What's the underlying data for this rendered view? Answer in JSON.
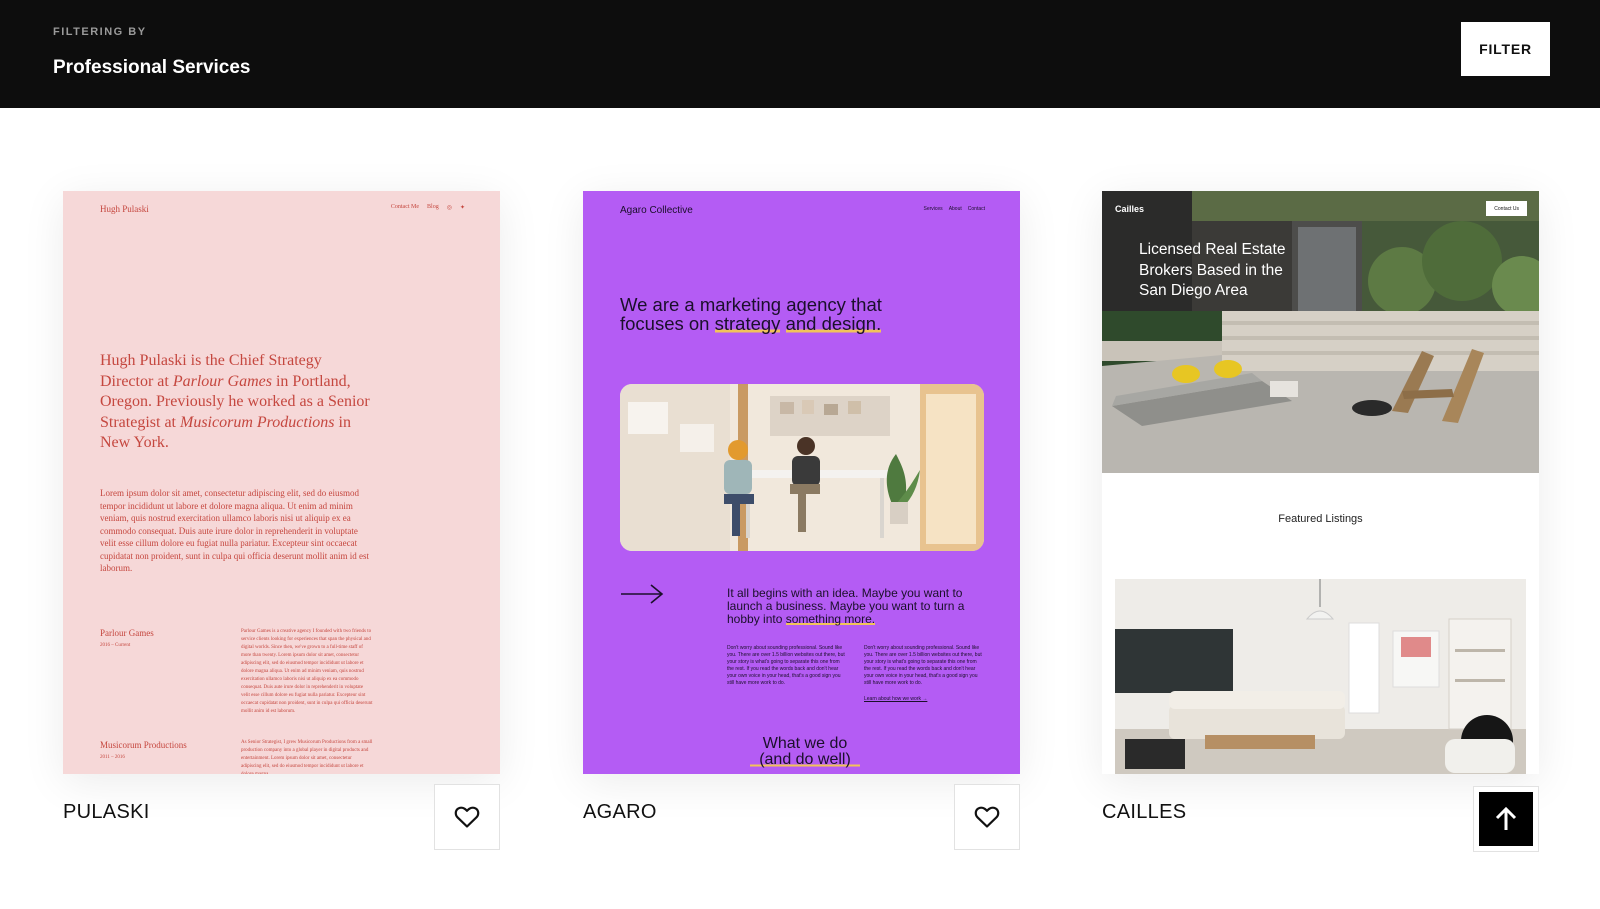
{
  "filter": {
    "eyebrow": "FILTERING BY",
    "value": "Professional Services",
    "button_label": "FILTER"
  },
  "templates": [
    {
      "name": "PULASKI",
      "bg_color": "#f6d8d8",
      "text_color": "#c5473f",
      "brand": "Hugh Pulaski",
      "nav": [
        "Contact Me",
        "Blog"
      ],
      "headline_parts": [
        "Hugh Pulaski is the Chief Strategy Director at ",
        "Parlour Games",
        " in Portland, Oregon. Previously he worked as a Senior Strategist at ",
        "Musicorum Productions",
        " in New York."
      ],
      "lorem": "Lorem ipsum dolor sit amet, consectetur adipiscing elit, sed do eiusmod tempor incididunt ut labore et dolore magna aliqua. Ut enim ad minim veniam, quis nostrud exercitation ullamco laboris nisi ut aliquip ex ea commodo consequat. Duis aute irure dolor in reprehenderit in voluptate velit esse cillum dolore eu fugiat nulla pariatur. Excepteur sint occaecat cupidatat non proident, sunt in culpa qui officia deserunt mollit anim id est laborum.",
      "section1_title": "Parlour Games",
      "section1_dates": "2016 – Current",
      "section1_body": "Parlour Games is a creative agency I founded with two friends to service clients looking for experiences that span the physical and digital worlds. Since then, we've grown to a full-time staff of more than twenty. Lorem ipsum dolor sit amet, consectetur adipiscing elit, sed do eiusmod tempor incididunt ut labore et dolore magna aliqua. Ut enim ad minim veniam, quis nostrud exercitation ullamco laboris nisi ut aliquip ex ea commodo consequat. Duis aute irure dolor in reprehenderit in voluptate velit esse cillum dolore eu fugiat nulla pariatur. Excepteur sint occaecat cupidatat non proident, sunt in culpa qui officia deserunt mollit anim id est laborum.",
      "section2_title": "Musicorum Productions",
      "section2_dates": "2011 – 2016",
      "section2_body": "As Senior Strategist, I grew Musicorum Productions from a small production company into a global player in digital products and entertainment. Lorem ipsum dolor sit amet, consectetur adipiscing elit, sed do eiusmod tempor incididunt ut labore et dolore magna."
    },
    {
      "name": "AGARO",
      "bg_color": "#b45cf4",
      "highlight_color": "#f2c35a",
      "brand": "Agaro Collective",
      "nav": [
        "Services",
        "About",
        "Contact"
      ],
      "headline_plain": "We are a marketing agency that focuses on ",
      "headline_hl1": "strategy",
      "headline_hl2": "and design.",
      "para_plain": "It all begins with an idea. Maybe you want to launch a business. Maybe you want to turn a hobby into ",
      "para_hl": "something more.",
      "small_text": "Don't worry about sounding professional. Sound like you. There are over 1.5 billion websites out there, but your story is what's going to separate this one from the rest. If you read the words back and don't hear your own voice in your head, that's a good sign you still have more work to do.",
      "link": "Learn about how we work →",
      "what_we_do": "What we do",
      "and_do_well": "(and do well)"
    },
    {
      "name": "CAILLES",
      "brand": "Cailles",
      "contact_button": "Contact Us",
      "headline": "Licensed Real Estate Brokers Based in the San Diego Area",
      "featured": "Featured Listings"
    }
  ]
}
